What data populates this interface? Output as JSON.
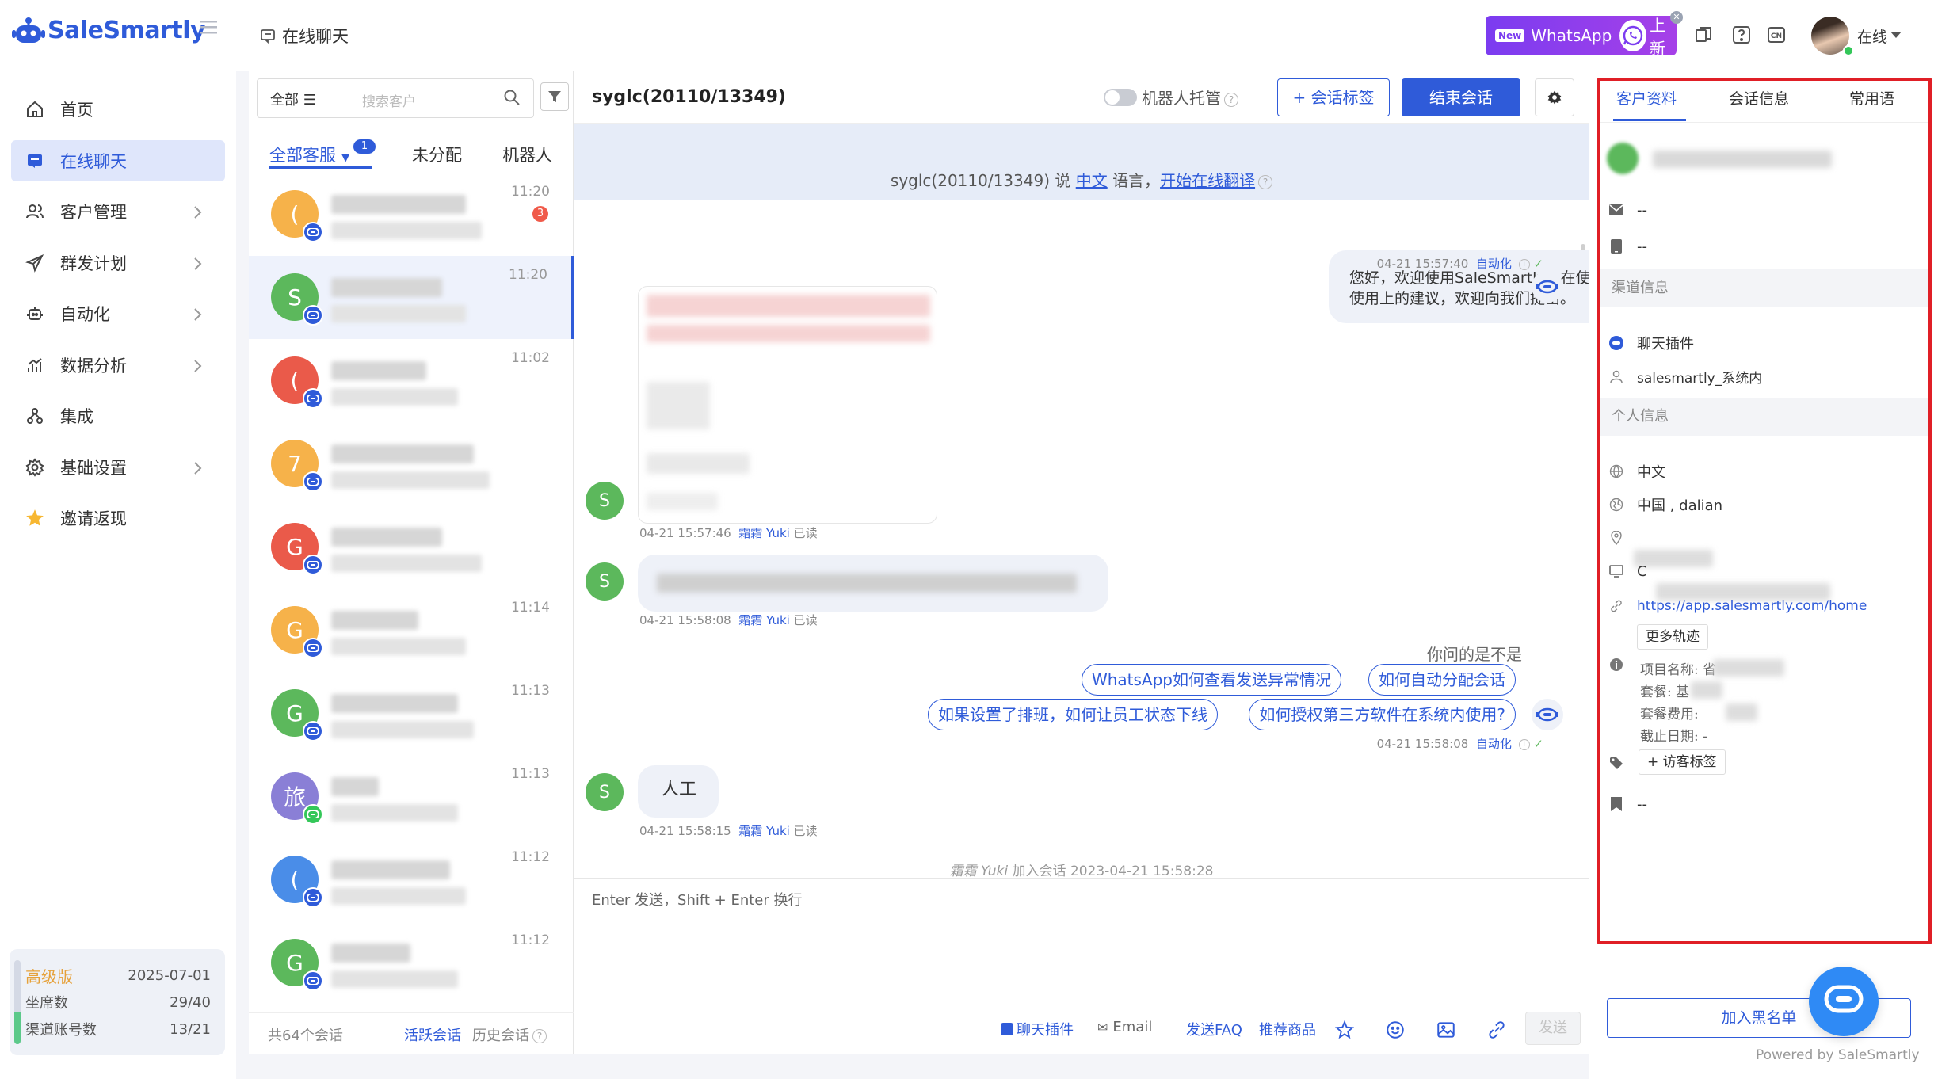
{
  "app": {
    "brand": "SaleSmartly",
    "brand_color": "#2f5bd9",
    "accent_red": "#e01f26"
  },
  "sidebar": {
    "items": [
      {
        "label": "首页",
        "icon": "home-icon"
      },
      {
        "label": "在线聊天",
        "icon": "chat-icon",
        "active": true
      },
      {
        "label": "客户管理",
        "icon": "users-icon"
      },
      {
        "label": "群发计划",
        "icon": "send-icon"
      },
      {
        "label": "自动化",
        "icon": "robot-icon"
      },
      {
        "label": "数据分析",
        "icon": "chart-icon"
      },
      {
        "label": "集成",
        "icon": "integration-icon"
      },
      {
        "label": "基础设置",
        "icon": "settings-icon"
      },
      {
        "label": "邀请返现",
        "icon": "star-icon"
      }
    ],
    "plan": {
      "name": "高级版",
      "expiry": "2025-07-01",
      "seats_label": "坐席数",
      "seats_value": "29/40",
      "channels_label": "渠道账号数",
      "channels_value": "13/21"
    }
  },
  "header": {
    "page_title": "在线聊天",
    "whatsapp_banner": {
      "new_badge": "New",
      "label": "WhatsApp",
      "suffix": "上新"
    },
    "status": "在线"
  },
  "conv_list": {
    "scope": "全部",
    "search_placeholder": "搜索客户",
    "tabs": [
      "全部客服",
      "未分配",
      "机器人"
    ],
    "tab_badge": "1",
    "items": [
      {
        "initial": "(",
        "color": "#f6b24a",
        "time": "11:20",
        "unread": "3"
      },
      {
        "initial": "S",
        "color": "#5cb85c",
        "time": "11:20",
        "selected": true
      },
      {
        "initial": "(",
        "color": "#ea5a4a",
        "time": "11:02"
      },
      {
        "initial": "7",
        "color": "#f6b24a",
        "time": ""
      },
      {
        "initial": "G",
        "color": "#ea5a4a",
        "time": ""
      },
      {
        "initial": "G",
        "color": "#f6b24a",
        "time": "11:14"
      },
      {
        "initial": "G",
        "color": "#5cb85c",
        "time": "11:13"
      },
      {
        "initial": "旅",
        "color": "#8a7fd6",
        "time": "11:13"
      },
      {
        "initial": "(",
        "color": "#4a8de8",
        "time": "11:12"
      },
      {
        "initial": "G",
        "color": "#5cb85c",
        "time": "11:12"
      }
    ],
    "footer": {
      "total": "共64个会话",
      "active": "活跃会话",
      "history": "历史会话"
    }
  },
  "chat": {
    "title": "syglc(20110/13349)",
    "robot_label": "机器人托管",
    "tag_button": "+ 会话标签",
    "end_button": "结束会话",
    "lang_notice": {
      "prefix": "syglc(20110/13349) 说 ",
      "lang": "中文",
      "mid": " 语言，",
      "action": "开始在线翻译"
    },
    "welcome": {
      "text_line1": "您好，欢迎使用SaleSmartly，在使用过程中有任何疑问可随时咨询我们，若您有任何",
      "text_line2": "使用上的建议，欢迎向我们提出。",
      "time": "04-21 15:57:40",
      "tag": "自动化"
    },
    "msg1_meta": {
      "time": "04-21 15:57:46",
      "agent": "霜霜 Yuki",
      "read": "已读"
    },
    "msg2_meta": {
      "time": "04-21 15:58:08",
      "agent": "霜霜 Yuki",
      "read": "已读"
    },
    "faq": {
      "prompt": "你问的是不是",
      "chips": [
        "WhatsApp如何查看发送异常情况",
        "如何自动分配会话",
        "如果设置了排班，如何让员工状态下线",
        "如何授权第三方软件在系统内使用?"
      ],
      "time": "04-21 15:58:08",
      "tag": "自动化"
    },
    "manual": {
      "text": "人工",
      "time": "04-21 15:58:15",
      "agent": "霜霜 Yuki",
      "read": "已读"
    },
    "join_note": {
      "agent": "霜霜 Yuki",
      "text": " 加入会话 2023-04-21 15:58:28"
    },
    "composer_placeholder": "Enter 发送，Shift + Enter 换行",
    "tools": {
      "plugin": "聊天插件",
      "email": "Email",
      "faq": "发送FAQ",
      "product": "推荐商品"
    },
    "send": "发送"
  },
  "right_panel": {
    "tabs": [
      "客户资料",
      "会话信息",
      "常用语"
    ],
    "email": "--",
    "phone": "--",
    "channel_section": "渠道信息",
    "channel_type": "聊天插件",
    "channel_name": "salesmartly_系统内",
    "personal_section": "个人信息",
    "language": "中文",
    "location": "中国 , dalian",
    "device_prefix": "C",
    "url": "https://app.salesmartly.com/home",
    "more_track": "更多轨迹",
    "project": {
      "name": "项目名称: 省",
      "package": "套餐: 基",
      "fee": "套餐费用: ",
      "deadline": "截止日期: -"
    },
    "visitor_tag": "+ 访客标签",
    "note": "--",
    "blacklist": "加入黑名单",
    "powered": "Powered by SaleSmartly"
  }
}
